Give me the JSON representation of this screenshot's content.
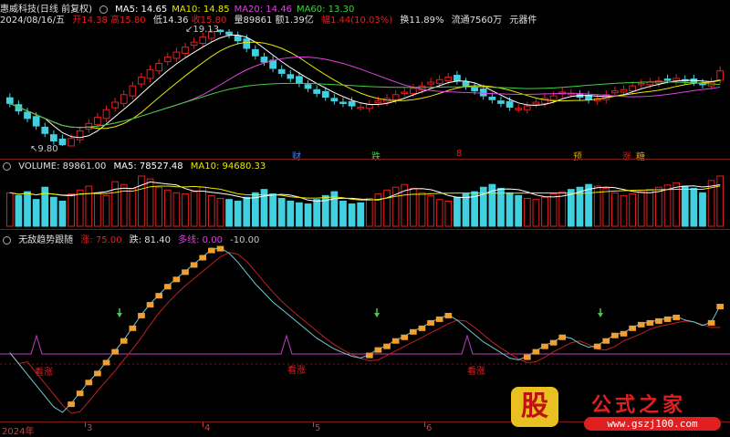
{
  "header": {
    "stock_title": "惠威科技(日线 前复权)",
    "ma_labels": [
      {
        "text": "MA5: 14.65",
        "color": "#ffffff"
      },
      {
        "text": "MA10: 14.85",
        "color": "#e8e800"
      },
      {
        "text": "MA20: 14.46",
        "color": "#e040e0"
      },
      {
        "text": "MA60: 13.30",
        "color": "#40d040"
      }
    ]
  },
  "info": {
    "date": "2024/08/16/五",
    "open": "开14.38",
    "high": "高15.80",
    "low": "低14.36",
    "close": "收15.80",
    "volume": "量89861",
    "amount": "额1.39亿",
    "change": "幅1.44(10.03%)",
    "turnover": "换11.89%",
    "float": "流通7560万",
    "sector": "元器件"
  },
  "price_annotations": {
    "high_label": "19.13",
    "low_label": "9.80",
    "signal_tags": [
      {
        "text": "财",
        "color": "#4080ff"
      },
      {
        "text": "跌",
        "color": "#40d040"
      },
      {
        "text": "8",
        "color": "#e02020"
      },
      {
        "text": "预",
        "color": "#e0a000"
      },
      {
        "text": "涨",
        "color": "#e02020"
      },
      {
        "text": "糖",
        "color": "#e0a000"
      }
    ]
  },
  "volume_header": {
    "label": "VOLUME: 89861.00",
    "ma5": "MA5: 78527.48",
    "ma10": "MA10: 94680.33"
  },
  "indicator_header": {
    "name": "无敌趋势跟随",
    "up": "涨: 75.00",
    "down": "跌: 81.40",
    "many": "多线: 0.00",
    "value": "-10.00"
  },
  "indicator_tags": {
    "buy": "看涨"
  },
  "date_axis": [
    "2024年",
    "3",
    "4",
    "5",
    "6"
  ],
  "logo": {
    "badge": "股",
    "title": "公式之家",
    "url": "www.gszj100.com"
  },
  "colors": {
    "up": "#e02020",
    "down": "#40d0e0",
    "ma5": "#ffffff",
    "ma10": "#e8e800",
    "ma20": "#e040e0",
    "ma60": "#40d040",
    "indicator_up": "#f0a030",
    "baseline": "#c040c0"
  },
  "chart_data": {
    "type": "candlestick",
    "price_range": [
      9.8,
      19.13
    ],
    "closes": [
      13.2,
      12.6,
      12.0,
      11.4,
      10.8,
      10.2,
      9.9,
      10.4,
      11.0,
      11.6,
      12.1,
      12.7,
      13.3,
      13.9,
      14.6,
      15.3,
      15.9,
      16.4,
      16.9,
      17.3,
      17.7,
      18.1,
      18.5,
      18.9,
      19.0,
      18.7,
      18.2,
      17.6,
      17.0,
      16.5,
      16.0,
      15.6,
      15.2,
      14.8,
      14.4,
      14.0,
      13.7,
      13.4,
      13.2,
      13.0,
      12.9,
      13.1,
      13.4,
      13.6,
      13.9,
      14.1,
      14.4,
      14.6,
      14.9,
      15.1,
      15.3,
      15.0,
      14.6,
      14.2,
      13.8,
      13.5,
      13.2,
      12.9,
      12.8,
      13.0,
      13.3,
      13.6,
      13.8,
      14.1,
      14.0,
      13.7,
      13.5,
      13.6,
      13.9,
      14.2,
      14.3,
      14.6,
      14.8,
      14.9,
      15.0,
      15.1,
      15.2,
      15.0,
      14.9,
      14.7,
      14.9,
      15.8
    ],
    "volumes": [
      60,
      55,
      62,
      48,
      70,
      52,
      45,
      58,
      65,
      72,
      60,
      55,
      80,
      75,
      68,
      90,
      85,
      70,
      65,
      60,
      58,
      62,
      70,
      55,
      50,
      48,
      45,
      52,
      60,
      66,
      58,
      50,
      45,
      42,
      40,
      48,
      55,
      62,
      45,
      40,
      42,
      50,
      58,
      65,
      70,
      75,
      68,
      60,
      55,
      48,
      45,
      52,
      58,
      62,
      70,
      75,
      68,
      60,
      55,
      50,
      48,
      52,
      58,
      62,
      66,
      70,
      75,
      72,
      68,
      60,
      55,
      58,
      62,
      66,
      70,
      74,
      78,
      72,
      68,
      60,
      82,
      90
    ],
    "volume_unit": "shares",
    "indicator": {
      "name": "无敌趋势跟随",
      "up": 75.0,
      "down": 81.4,
      "many": 0.0,
      "value": -10.0
    }
  }
}
